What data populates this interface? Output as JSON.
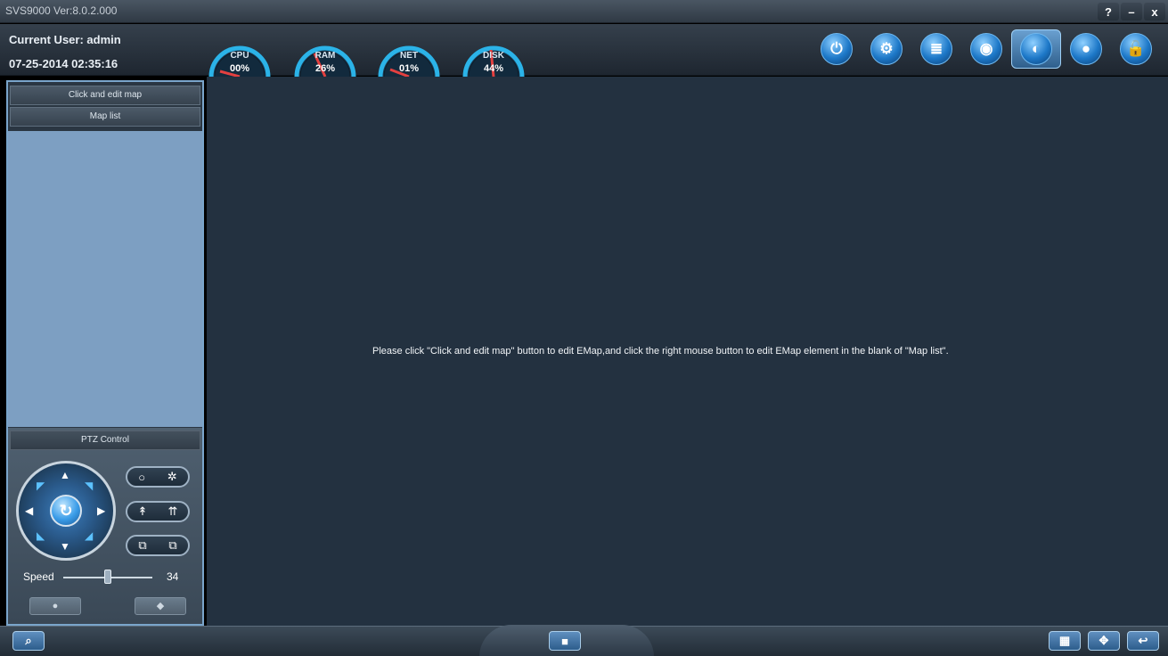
{
  "titlebar": {
    "title": "SVS9000 Ver:8.0.2.000",
    "help": "?",
    "minimize": "–",
    "close": "x"
  },
  "header": {
    "user": "Current User: admin",
    "datetime": "07-25-2014 02:35:16",
    "gauges": [
      {
        "label": "CPU",
        "value": "00%"
      },
      {
        "label": "RAM",
        "value": "26%"
      },
      {
        "label": "NET",
        "value": "01%"
      },
      {
        "label": "DISK",
        "value": "44%"
      }
    ]
  },
  "toolbar_icons": [
    {
      "name": "power-icon",
      "glyph": "⏻"
    },
    {
      "name": "settings-icon",
      "glyph": "⚙"
    },
    {
      "name": "search-record-icon",
      "glyph": "≣"
    },
    {
      "name": "playback-icon",
      "glyph": "◉"
    },
    {
      "name": "emap-icon",
      "glyph": "◐",
      "active": true
    },
    {
      "name": "camera-icon",
      "glyph": "●"
    },
    {
      "name": "lock-icon",
      "glyph": "🔓"
    }
  ],
  "left_panel": {
    "edit_map_button": "Click and edit map",
    "map_list_label": "Map list",
    "ptz_title": "PTZ Control",
    "speed_label": "Speed",
    "speed_value": "34",
    "speed": 34
  },
  "main": {
    "hint": "Please click \"Click and edit map\" button to edit EMap,and click the right mouse button to edit EMap element in the blank of \"Map list\"."
  },
  "colors": {
    "accent": "#1d78c8",
    "map_list_bg": "#7d9fc2",
    "main_bg": "#233140"
  }
}
